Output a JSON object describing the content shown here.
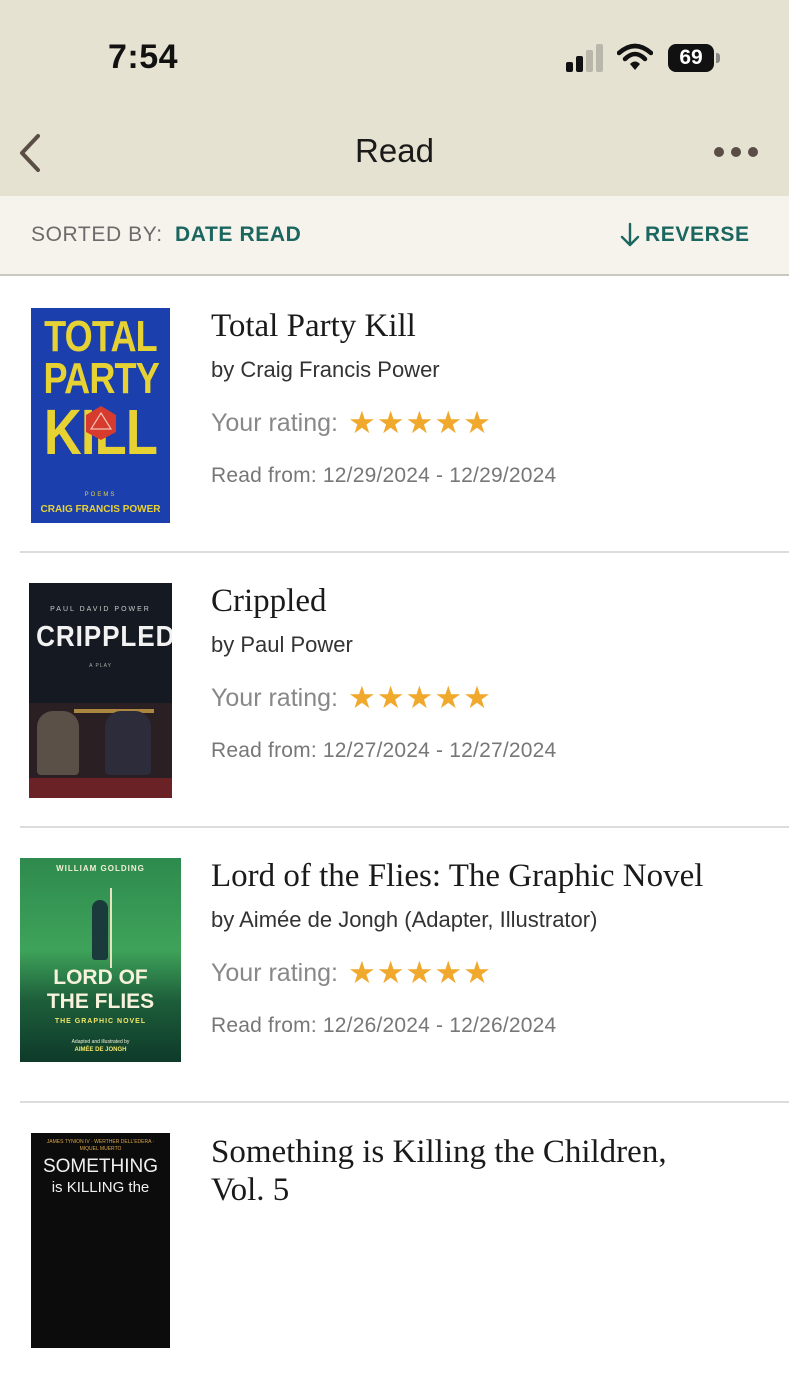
{
  "status": {
    "time": "7:54",
    "battery": "69"
  },
  "nav": {
    "title": "Read"
  },
  "sort": {
    "label": "SORTED BY:",
    "value": "DATE READ",
    "reverse": "REVERSE"
  },
  "rating_label": "Your rating:",
  "books": [
    {
      "title": "Total Party Kill",
      "author": "by Craig Francis Power",
      "stars": 5,
      "dates": "Read from: 12/29/2024 - 12/29/2024",
      "cover": {
        "line1": "TOTAL",
        "line2": "PARTY",
        "line3": "KILL",
        "sub": "POEMS",
        "author": "CRAIG FRANCIS POWER"
      }
    },
    {
      "title": "Crippled",
      "author": "by Paul Power",
      "stars": 5,
      "dates": "Read from: 12/27/2024 - 12/27/2024",
      "cover": {
        "top": "PAUL DAVID POWER",
        "title": "CRIPPLED",
        "sub": "A PLAY"
      }
    },
    {
      "title": "Lord of the Flies: The Graphic Novel",
      "author": "by Aimée de Jongh (Adapter, Illustrator)",
      "stars": 5,
      "dates": "Read from: 12/26/2024 - 12/26/2024",
      "cover": {
        "top": "WILLIAM GOLDING",
        "title1": "LORD OF",
        "title2": "THE FLIES",
        "sub": "THE GRAPHIC NOVEL",
        "credit1": "Adapted and illustrated by",
        "credit2": "AIMÉE DE JONGH"
      }
    },
    {
      "title_line1": "Something is Killing the Children,",
      "title_line2": "Vol. 5",
      "cover": {
        "names": "JAMES TYNION IV · WERTHER DELL'EDERA · MIQUEL MUERTO",
        "line1": "SOMETHING",
        "line2": "is KILLING the"
      }
    }
  ],
  "colors": {
    "accent": "#1c6660",
    "star": "#f0a92d",
    "header_bg": "#e6e2d1"
  }
}
